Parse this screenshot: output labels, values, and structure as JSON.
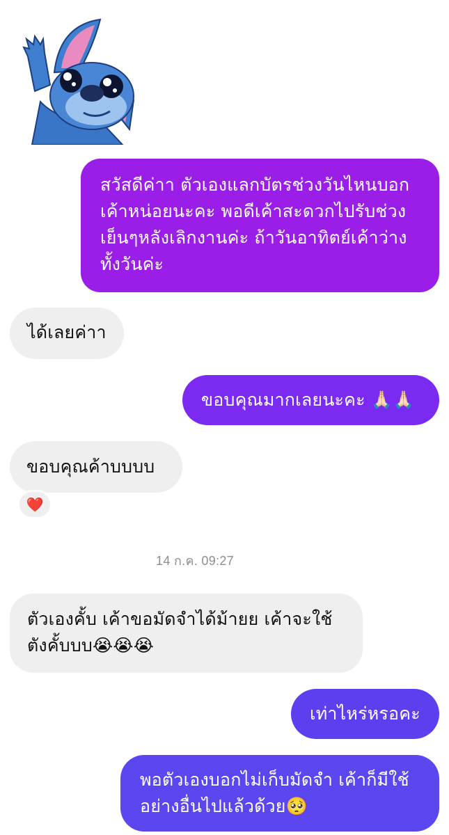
{
  "messages": [
    {
      "id": 1,
      "side": "out",
      "text": "สวัสดีค่าา ตัวเองแลกบัตรช่วงวันไหนบอก\nเค้าหน่อยนะคะ พอดีเค้าสะดวกไปรับช่วง\nเย็นๆหลังเลิกงานค่ะ ถ้าวันอาทิตย์เค้าว่าง\nทั้งวันค่ะ"
    },
    {
      "id": 2,
      "side": "in",
      "text": "ได้เลยค่าา"
    },
    {
      "id": 3,
      "side": "out",
      "text": "ขอบคุณมากเลยนะคะ 🙏🏻🙏🏻"
    },
    {
      "id": 4,
      "side": "in",
      "text": "ขอบคุณค้าบบบบ",
      "reaction": "❤️"
    },
    {
      "id": 5,
      "side": "in",
      "text": "ตัวเองคั้บ เค้าขอมัดจำได้ม้ายย เค้าจะใช้\nตังคั้บบบ😭😭😭"
    },
    {
      "id": 6,
      "side": "out",
      "text": "เท่าไหร่หรอคะ"
    },
    {
      "id": 7,
      "side": "out",
      "text": "พอตัวเองบอกไม่เก็บมัดจำ เค้าก็มีใช้\nอย่างอื่นไปแล้วด้วย🥺"
    }
  ],
  "timestamp": "14 ก.ค. 09:27",
  "sticker": "stitch-waving-sticker",
  "colors": {
    "incoming_bubble": "#efefef",
    "outgoing_bubble_top": "#9b1ee8",
    "outgoing_bubble_bottom": "#5b46ef"
  }
}
